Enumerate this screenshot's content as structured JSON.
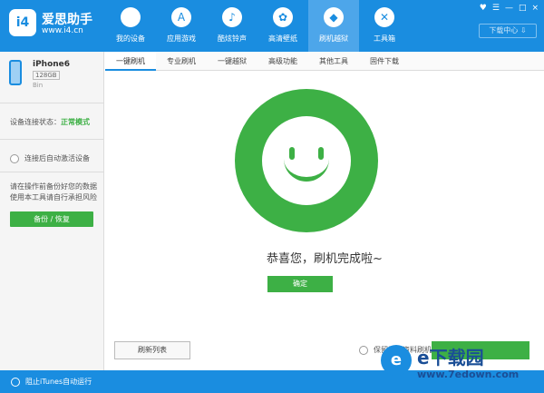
{
  "app": {
    "logo_badge": "i4",
    "name": "爱思助手",
    "url": "www.i4.cn"
  },
  "nav": [
    {
      "icon": "apple-icon",
      "glyph": "",
      "label": "我的设备"
    },
    {
      "icon": "app-store-icon",
      "glyph": "A",
      "label": "应用游戏"
    },
    {
      "icon": "bell-icon",
      "glyph": "♪",
      "label": "酷炫铃声"
    },
    {
      "icon": "flower-icon",
      "glyph": "✿",
      "label": "高清壁纸"
    },
    {
      "icon": "dropbox-icon",
      "glyph": "◆",
      "label": "刷机越狱"
    },
    {
      "icon": "tools-icon",
      "glyph": "✕",
      "label": "工具箱"
    }
  ],
  "header": {
    "download_center": "下载中心 ⇩",
    "controls": [
      "♥",
      "☰",
      "—",
      "□",
      "×"
    ]
  },
  "device": {
    "name": "iPhone6",
    "storage": "128GB",
    "battery": "Bin"
  },
  "sidebar": {
    "status_label": "设备连接状态：",
    "status_value": "正常模式",
    "auto_activate": "连接后自动激活设备",
    "warning": "请在操作前备份好您的数据 使用本工具请自行承担风险",
    "backup_button": "备份 / 恢复"
  },
  "tabs": [
    "一键刷机",
    "专业刷机",
    "一键越狱",
    "高级功能",
    "其他工具",
    "固件下载"
  ],
  "main": {
    "success_message": "恭喜您，刷机完成啦~",
    "confirm_button": "确定",
    "refresh_button": "刷新列表",
    "keep_data": "保留用户资料刷机"
  },
  "footer": {
    "itunes_block": "阻止iTunes自动运行"
  },
  "watermark": {
    "brand": "e下载园",
    "url": "www.7edown.com"
  },
  "colors": {
    "primary_blue": "#1a8de0",
    "success_green": "#3db045"
  }
}
